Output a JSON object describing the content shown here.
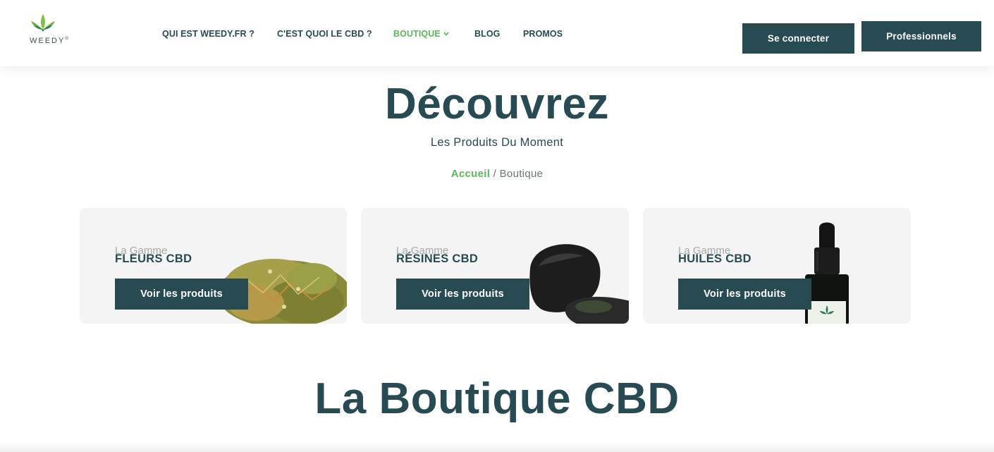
{
  "brand": {
    "name": "WEEDY",
    "mark": "®"
  },
  "nav": {
    "items": [
      {
        "label": "QUI EST WEEDY.FR ?"
      },
      {
        "label": "C'EST QUOI LE CBD ?"
      },
      {
        "label": "BOUTIQUE"
      },
      {
        "label": "BLOG"
      },
      {
        "label": "PROMOS"
      }
    ]
  },
  "header": {
    "login_label": "Se connecter",
    "pro_label": "Professionnels"
  },
  "hero": {
    "title": "Découvrez",
    "subtitle": "Les Produits Du Moment",
    "breadcrumb": {
      "home": "Accueil",
      "separator": " / ",
      "current": "Boutique"
    }
  },
  "cards": [
    {
      "kicker": "La Gamme",
      "name": "FLEURS CBD",
      "cta": "Voir les produits"
    },
    {
      "kicker": "La Gamme",
      "name": "RÉSINES CBD",
      "cta": "Voir les produits"
    },
    {
      "kicker": "La Gamme",
      "name": "HUILES CBD",
      "cta": "Voir les produits"
    }
  ],
  "section": {
    "title": "La Boutique CBD"
  },
  "colors": {
    "primary": "#284a52",
    "accent": "#5cb85c",
    "card_bg": "#f4f4f4"
  }
}
